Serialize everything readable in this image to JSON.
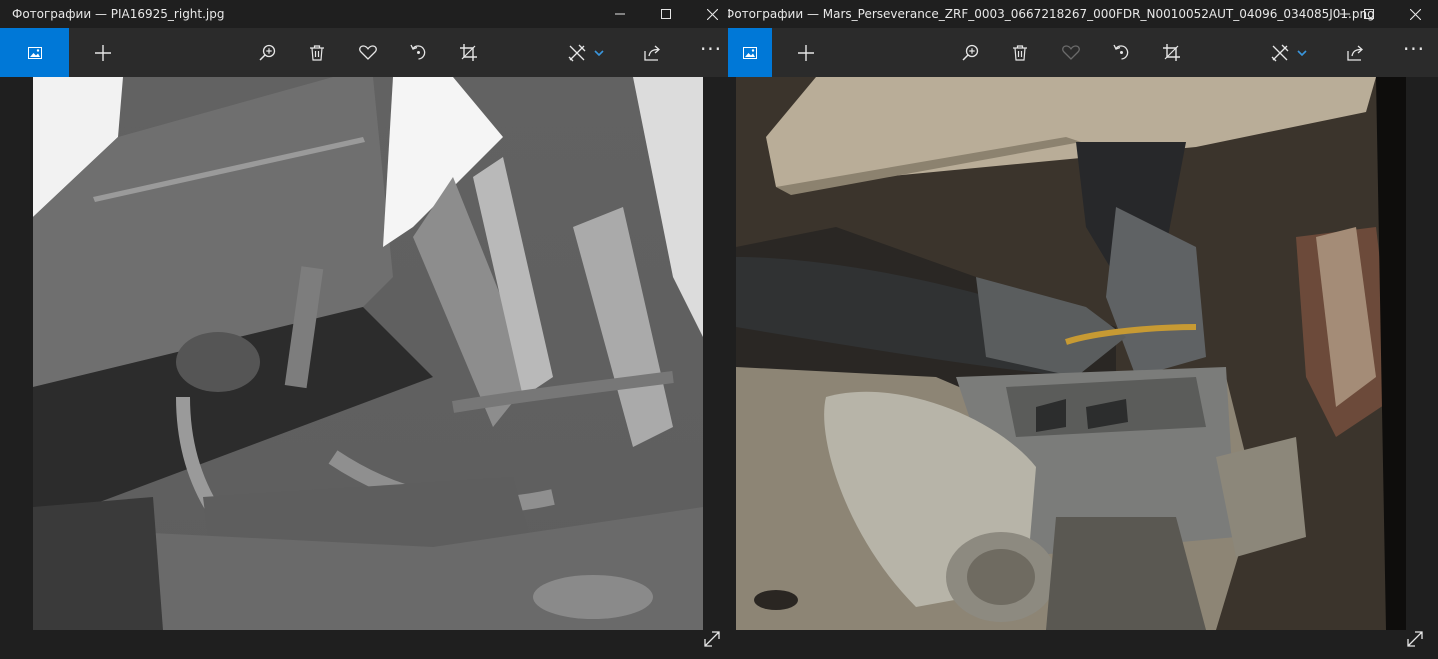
{
  "windows": [
    {
      "title": "Фотографии — PIA16925_right.jpg",
      "photo": "PIA16925_right.jpg",
      "favorite_enabled": true
    },
    {
      "title": "Фотографии — Mars_Perseverance_ZRF_0003_0667218267_000FDR_N0010052AUT_04096_034085J01.png",
      "photo": "Mars_Perseverance_ZRF_0003_0667218267_000FDR_N0010052AUT_04096_034085J01.png",
      "favorite_enabled": false
    }
  ],
  "toolbar": {
    "icons": [
      "gallery-icon",
      "add-icon",
      "zoom-in-icon",
      "delete-icon",
      "favorite-icon",
      "rotate-icon",
      "crop-icon",
      "edit-draw-icon",
      "chevron-down-icon",
      "share-icon",
      "more-icon"
    ],
    "more_label": "···"
  },
  "colors": {
    "accent": "#0078d7",
    "titlebar": "#1f1f1f",
    "toolbar": "#2b2b2b"
  }
}
